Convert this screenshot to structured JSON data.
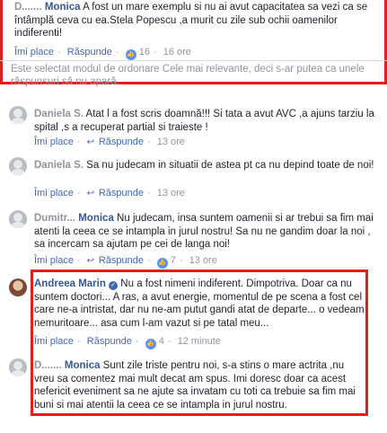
{
  "sort_notice": "Este selectat modul de ordonare Cele mai relevante, deci s-ar putea ca unele răspunsuri să nu apară.",
  "like_label": "Îmi place",
  "reply_label": "Răspunde",
  "comments": [
    {
      "author_hidden": "D.......",
      "author": "Monica",
      "text": "A fost un mare exemplu si nu ai avut capacitatea sa vezi ca se întâmplă ceva cu ea.Stela Popescu ,a murit cu zile sub ochii oamenilor indiferenti!",
      "likes": "16",
      "time": "16 ore"
    },
    {
      "author_hidden": "Daniela S.",
      "author": "",
      "text": "Atat l a fost scris doamnă!!! Si tata a avut AVC ,a ajuns tarziu la spital ,s a recuperat partial si traieste !",
      "likes": "",
      "time": "13 ore"
    },
    {
      "author_hidden": "Daniela S.",
      "author": "",
      "text": "Sa nu judecam in situatii de astea pt ca nu depind toate de noi!",
      "likes": "",
      "time": "13 ore"
    },
    {
      "author_hidden": "Dumitr...",
      "author": "Monica",
      "text": "Nu judecam, insa suntem oamenii si ar trebui sa fim mai atenti la ceea ce se intampla in jurul nostru! Sa nu ne gandim doar la noi , sa incercam sa ajutam pe cei de langa noi!",
      "likes": "7",
      "time": "13 ore"
    },
    {
      "author": "Andreea Marin",
      "text": "Nu a fost nimeni indiferent. Dimpotriva. Doar ca nu suntem doctori... A ras, a avut energie, momentul de pe scena a fost cel care ne-a intristat, dar nu ne-am putut gandi atat de departe... o vedeam nemuritoare... asa cum l-am vazut si pe tatal meu...",
      "likes": "4",
      "time": "12 minute"
    },
    {
      "author_hidden": "D.......",
      "author": "Monica",
      "text": "Sunt zile triste pentru noi, s-a stins o mare actrita ,nu vreu sa comentez mai mult decat am spus. Imi doresc doar ca acest nefericit eveniment sa ne ajute sa invatam cu toti ca trebuie sa fim mai buni si mai atentii la ceea ce se intampla in jurul nostru.",
      "likes": "",
      "time": ""
    }
  ],
  "colors": {
    "highlight": "#e0201f",
    "link": "#365899",
    "meta": "#90949c"
  }
}
